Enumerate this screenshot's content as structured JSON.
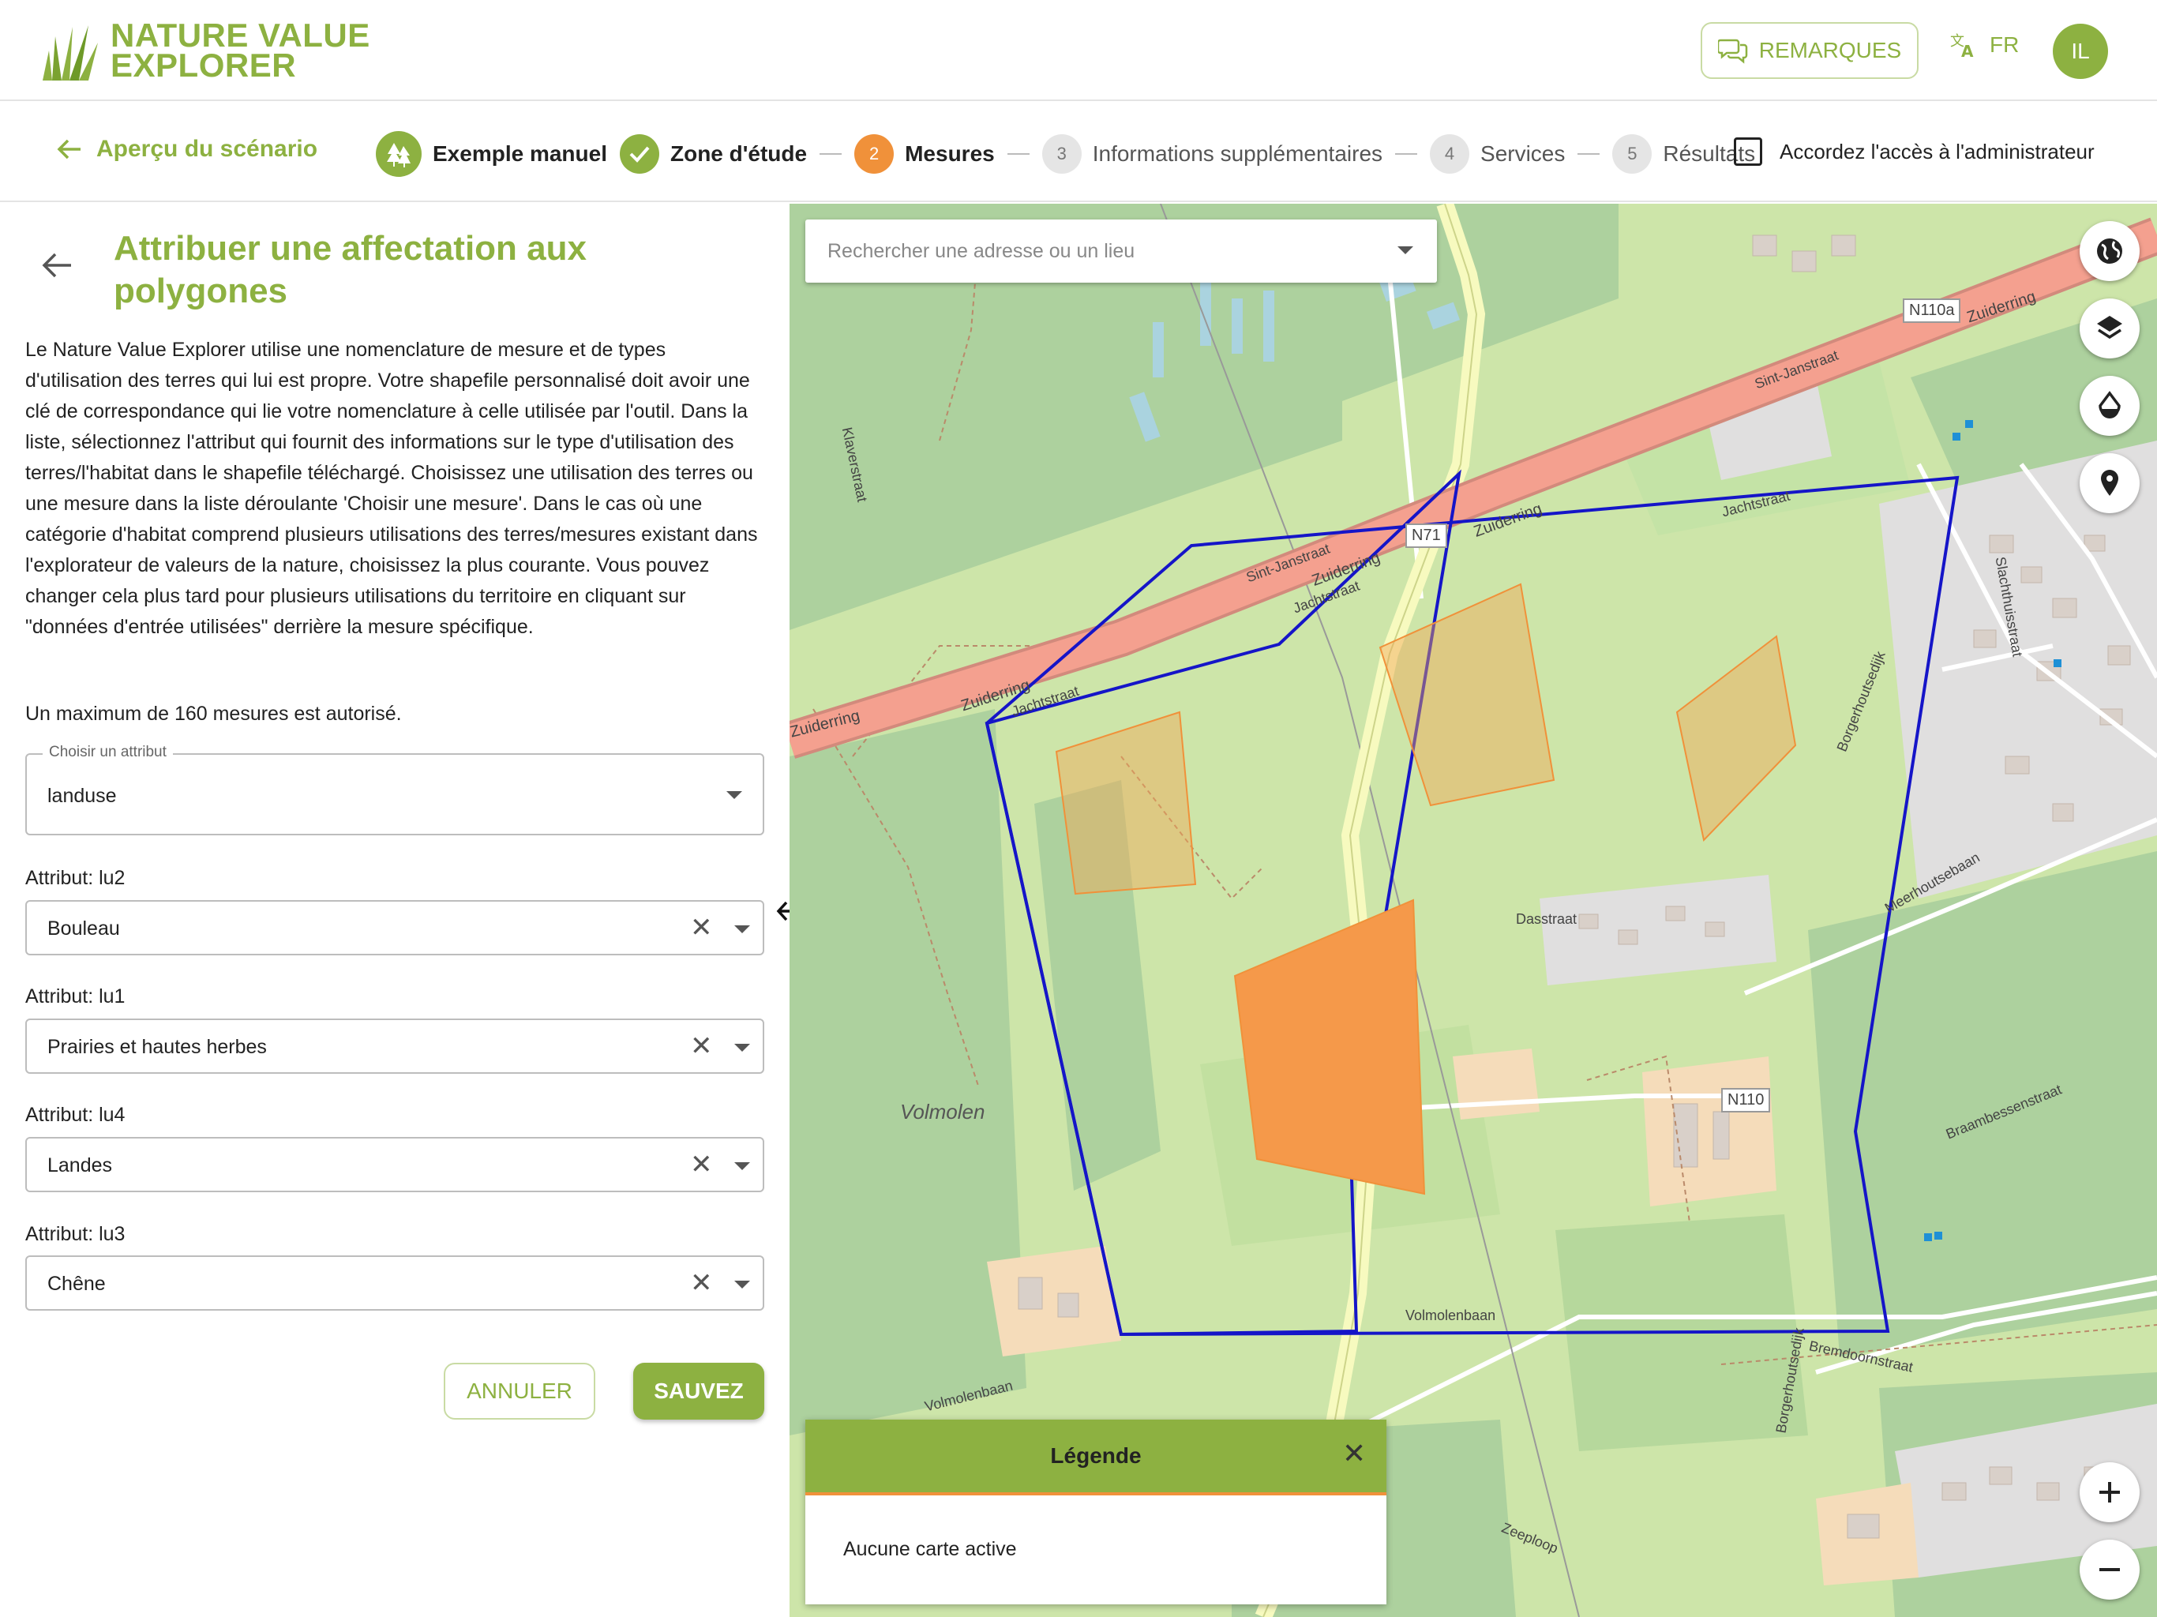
{
  "header": {
    "logo_line1": "NATURE VALUE",
    "logo_line2": "EXPLORER",
    "remarks_button": "REMARQUES",
    "language": "FR",
    "avatar_initials": "IL"
  },
  "stepbar": {
    "back_label": "Aperçu du scénario",
    "steps": [
      {
        "label": "Exemple manuel",
        "state": "root"
      },
      {
        "label": "Zone d'étude",
        "state": "done"
      },
      {
        "label": "Mesures",
        "number": "2",
        "state": "active"
      },
      {
        "label": "Informations supplémentaires",
        "number": "3",
        "state": "todo"
      },
      {
        "label": "Services",
        "number": "4",
        "state": "todo"
      },
      {
        "label": "Résultats",
        "number": "5",
        "state": "todo"
      }
    ],
    "admin_access_label": "Accordez l'accès à l'administrateur",
    "admin_access_checked": false
  },
  "panel": {
    "title": "Attribuer une affectation aux polygones",
    "description": "Le Nature Value Explorer utilise une nomenclature de mesure et de types d'utilisation des terres qui lui est propre. Votre shapefile personnalisé doit avoir une clé de correspondance qui lie votre nomenclature à celle utilisée par l'outil. Dans la liste, sélectionnez l'attribut qui fournit des informations sur le type d'utilisation des terres/l'habitat dans le shapefile téléchargé. Choisissez une utilisation des terres ou une mesure dans la liste déroulante 'Choisir une mesure'. Dans le cas où une catégorie d'habitat comprend plusieurs utilisations des terres/mesures existant dans l'explorateur de valeurs de la nature, choisissez la plus courante. Vous pouvez changer cela plus tard pour plusieurs utilisations du territoire en cliquant sur \"données d'entrée utilisées\" derrière la mesure spécifique.",
    "max_text": "Un maximum de 160 mesures est autorisé.",
    "attribute_select": {
      "label": "Choisir un attribut",
      "value": "landuse"
    },
    "attributes": [
      {
        "label": "Attribut: lu2",
        "value": "Bouleau"
      },
      {
        "label": "Attribut: lu1",
        "value": "Prairies et hautes herbes"
      },
      {
        "label": "Attribut: lu4",
        "value": "Landes"
      },
      {
        "label": "Attribut: lu3",
        "value": "Chêne"
      }
    ],
    "cancel_button": "ANNULER",
    "save_button": "SAUVEZ"
  },
  "map": {
    "search_placeholder": "Rechercher une adresse ou un lieu",
    "legend_title": "Légende",
    "legend_empty": "Aucune carte active",
    "labels": {
      "zuiderring": "Zuiderring",
      "n71": "N71",
      "n110a": "N110a",
      "n110": "N110",
      "sint_janstraat": "Sint-Janstraat",
      "jachtstraat": "Jachtstraat",
      "volmolen": "Volmolen",
      "volmolenbaan": "Volmolenbaan",
      "dasstraat": "Dasstraat",
      "meerhoutsebaan": "Meerhoutsebaan",
      "borgerhoutsedijk": "Borgerhoutsedijk",
      "bremdoornstraat": "Bremdoornstraat",
      "braambessenstraat": "Braambessenstraat",
      "klaverstraat": "Klaverstraat",
      "zeeploop": "Zeeploop",
      "slachthuisstraat": "Slachthuisstraat"
    }
  }
}
